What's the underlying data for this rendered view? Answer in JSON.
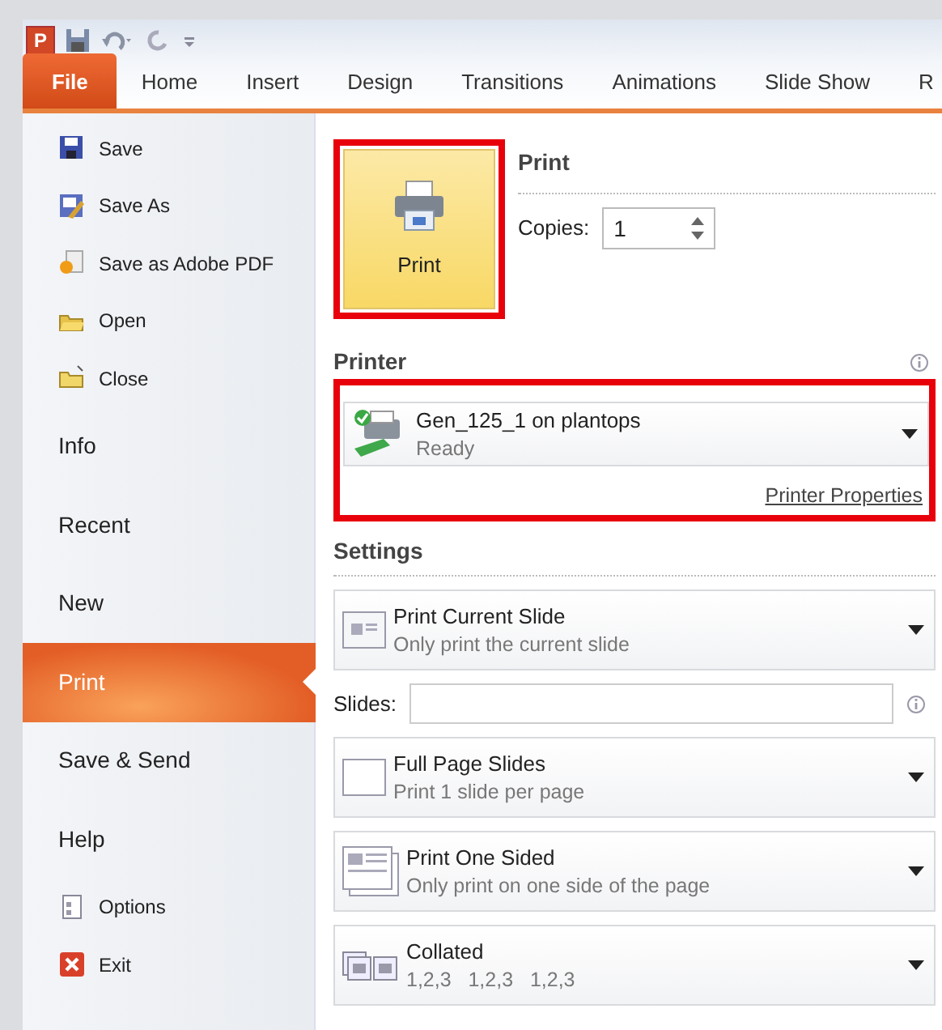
{
  "quick_access": {
    "app_icon": "P"
  },
  "ribbon_tabs": [
    {
      "label": "File",
      "selected": true
    },
    {
      "label": "Home",
      "selected": false
    },
    {
      "label": "Insert",
      "selected": false
    },
    {
      "label": "Design",
      "selected": false
    },
    {
      "label": "Transitions",
      "selected": false
    },
    {
      "label": "Animations",
      "selected": false
    },
    {
      "label": "Slide Show",
      "selected": false
    },
    {
      "label": "R",
      "selected": false
    }
  ],
  "sidebar": {
    "items": [
      {
        "kind": "command",
        "label": "Save",
        "selected": false
      },
      {
        "kind": "command",
        "label": "Save As",
        "selected": false
      },
      {
        "kind": "command",
        "label": "Save as Adobe PDF",
        "selected": false
      },
      {
        "kind": "command",
        "label": "Open",
        "selected": false
      },
      {
        "kind": "command",
        "label": "Close",
        "selected": false
      },
      {
        "kind": "page",
        "label": "Info",
        "selected": false
      },
      {
        "kind": "page",
        "label": "Recent",
        "selected": false
      },
      {
        "kind": "page",
        "label": "New",
        "selected": false
      },
      {
        "kind": "page",
        "label": "Print",
        "selected": true
      },
      {
        "kind": "page",
        "label": "Save & Send",
        "selected": false
      },
      {
        "kind": "page",
        "label": "Help",
        "selected": false
      },
      {
        "kind": "command",
        "label": "Options",
        "selected": false
      },
      {
        "kind": "command",
        "label": "Exit",
        "selected": false
      }
    ]
  },
  "print": {
    "button_label": "Print",
    "highlighted": true,
    "heading": "Print",
    "copies_label": "Copies:",
    "copies_value": "1"
  },
  "printer": {
    "heading": "Printer",
    "name": "Gen_125_1 on plantops",
    "status": "Ready",
    "properties_link": "Printer Properties",
    "highlighted": true
  },
  "settings": {
    "heading": "Settings",
    "items": [
      {
        "kind": "dropdown",
        "title": "Print Current Slide",
        "subtitle": "Only print the current slide"
      },
      {
        "kind": "field",
        "label": "Slides:"
      },
      {
        "kind": "dropdown",
        "title": "Full Page Slides",
        "subtitle": "Print 1 slide per page"
      },
      {
        "kind": "dropdown",
        "title": "Print One Sided",
        "subtitle": "Only print on one side of the page"
      },
      {
        "kind": "dropdown",
        "title": "Collated",
        "subtitle": "1,2,3   1,2,3   1,2,3"
      }
    ]
  }
}
